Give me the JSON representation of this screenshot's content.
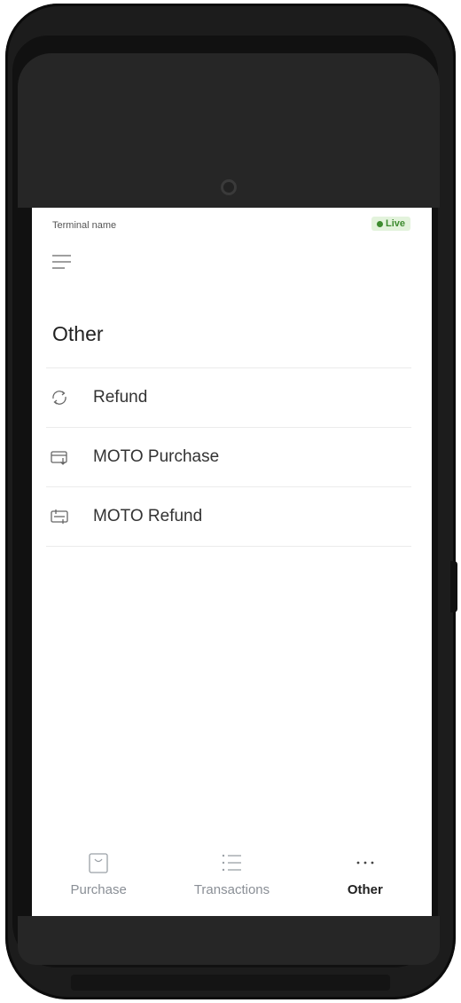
{
  "header": {
    "terminal_name": "Terminal name",
    "status_badge": "Live",
    "status_color": "#3d8b2f"
  },
  "page": {
    "title": "Other"
  },
  "menu": {
    "icon": "hamburger-menu-icon"
  },
  "list": {
    "items": [
      {
        "label": "Refund",
        "icon": "refresh-icon"
      },
      {
        "label": "MOTO Purchase",
        "icon": "card-download-icon"
      },
      {
        "label": "MOTO Refund",
        "icon": "card-exchange-icon"
      }
    ]
  },
  "bottom_nav": {
    "tabs": [
      {
        "label": "Purchase",
        "icon": "shopping-bag-icon",
        "active": false
      },
      {
        "label": "Transactions",
        "icon": "list-icon",
        "active": false
      },
      {
        "label": "Other",
        "icon": "more-dots-icon",
        "active": true
      }
    ]
  }
}
